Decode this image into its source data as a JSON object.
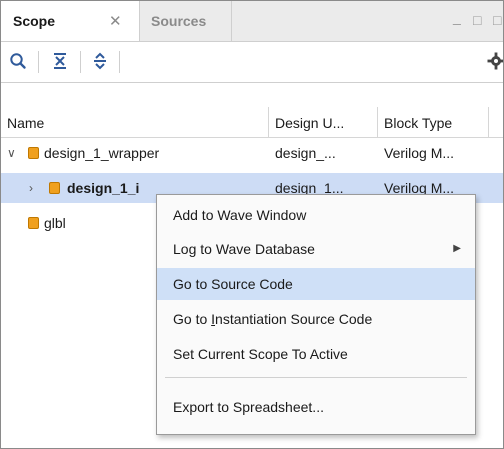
{
  "tabs": [
    {
      "label": "Scope",
      "active": true
    },
    {
      "label": "Sources",
      "active": false
    }
  ],
  "window_controls": {
    "minimize": "_",
    "maximize": "□",
    "restore": "□"
  },
  "toolbar": {
    "icons": [
      "search-icon",
      "collapse-all-icon",
      "expand-all-icon",
      "gear-icon"
    ]
  },
  "columns": [
    "Name",
    "Design U...",
    "Block Type"
  ],
  "rows": [
    {
      "name": "design_1_wrapper",
      "design_unit": "design_...",
      "block_type": "Verilog M...",
      "expanded": true,
      "level": 0
    },
    {
      "name": "design_1_i",
      "design_unit": "design_1...",
      "block_type": "Verilog M...",
      "expanded": false,
      "level": 1,
      "selected": true
    },
    {
      "name": "glbl",
      "design_unit": "",
      "block_type": "",
      "level": 0
    }
  ],
  "context_menu": {
    "items": [
      {
        "label": "Add to Wave Window"
      },
      {
        "label": "Log to Wave Database",
        "submenu": true
      },
      {
        "label": "Go to Source Code",
        "highlighted": true
      },
      {
        "label_pre": "Go to ",
        "label_u": "I",
        "label_post": "nstantiation Source Code"
      },
      {
        "label": "Set Current Scope To Active"
      },
      {
        "label": "Export to Spreadsheet..."
      }
    ]
  },
  "colors": {
    "accent": "#cfe0f7",
    "selection": "#cddcf5",
    "block_icon": "#f0a01e",
    "toolbar_icon": "#2f5a9b"
  }
}
